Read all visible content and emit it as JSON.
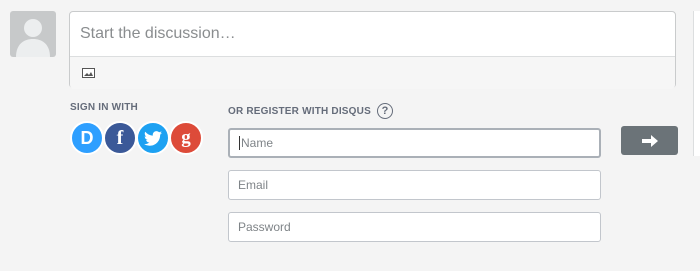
{
  "comment": {
    "placeholder": "Start the discussion…",
    "toolbar_icon": "image-icon"
  },
  "signin": {
    "label": "SIGN IN WITH",
    "providers": [
      {
        "name": "disqus",
        "glyph": "D",
        "color": "#2e9fff"
      },
      {
        "name": "facebook",
        "glyph": "f",
        "color": "#3b5998"
      },
      {
        "name": "twitter",
        "glyph": "twitter-bird-icon",
        "color": "#1da1f2"
      },
      {
        "name": "google",
        "glyph": "g",
        "color": "#dd4b39"
      }
    ]
  },
  "register": {
    "label": "OR REGISTER WITH DISQUS",
    "help_glyph": "?",
    "fields": {
      "name": {
        "placeholder": "Name",
        "value": ""
      },
      "email": {
        "placeholder": "Email",
        "value": ""
      },
      "password": {
        "placeholder": "Password",
        "value": ""
      }
    },
    "submit_icon": "arrow-right-icon"
  }
}
